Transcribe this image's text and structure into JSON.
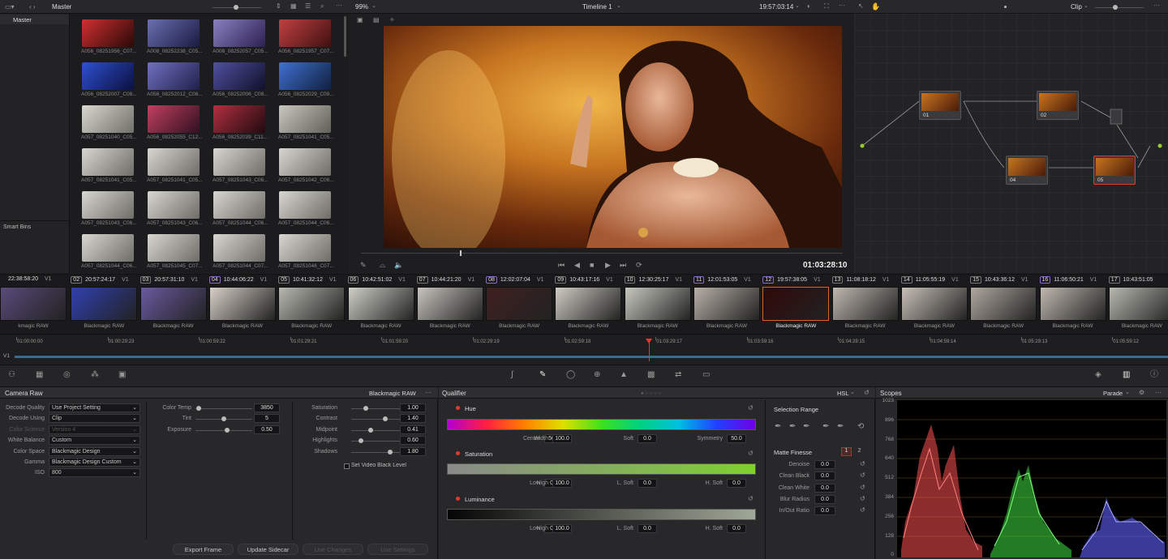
{
  "media_pool": {
    "title": "Master",
    "bins": [
      "Master"
    ],
    "smart_bins_label": "Smart Bins",
    "clips": [
      "A056_08251956_C07...",
      "A008_08252238_C05...",
      "A008_08252057_C05...",
      "A056_08251957_C07...",
      "A056_08252007_C08...",
      "A056_08252012_C08...",
      "A056_08252006_C08...",
      "A056_08252029_C09...",
      "A057_08251040_C05...",
      "A056_08252055_C12...",
      "A056_08252039_C11...",
      "A057_08251041_C05...",
      "A057_08251041_C05...",
      "A057_08251041_C05...",
      "A057_08251043_C06...",
      "A057_08251042_C06...",
      "A057_08251043_C06...",
      "A057_08251043_C06...",
      "A057_08251044_C06...",
      "A057_08251044_C06...",
      "A057_08251044_C06...",
      "A057_08251045_C07...",
      "A057_08251044_C07...",
      "A057_08251046_C07..."
    ]
  },
  "viewer": {
    "zoom": "99%",
    "timeline_name": "Timeline 1",
    "timecode_top": "19:57:03:14",
    "timecode_bottom": "01:03:28:10"
  },
  "node_editor": {
    "mode": "Clip",
    "nodes": [
      "01",
      "02",
      "04",
      "05"
    ]
  },
  "clip_strip": [
    {
      "num": "",
      "tc": "22:38:58:20",
      "track": "V1",
      "name": "kmagic RAW"
    },
    {
      "num": "02",
      "tc": "20:57:24:17",
      "track": "V1",
      "name": "Blackmagic RAW"
    },
    {
      "num": "03",
      "tc": "20:57:31:10",
      "track": "V1",
      "name": "Blackmagic RAW"
    },
    {
      "num": "04",
      "tc": "10:44:06:22",
      "track": "V1",
      "name": "Blackmagic RAW"
    },
    {
      "num": "05",
      "tc": "10:41:32:12",
      "track": "V1",
      "name": "Blackmagic RAW"
    },
    {
      "num": "06",
      "tc": "10:42:51:02",
      "track": "V1",
      "name": "Blackmagic RAW"
    },
    {
      "num": "07",
      "tc": "10:44:21:20",
      "track": "V1",
      "name": "Blackmagic RAW"
    },
    {
      "num": "08",
      "tc": "12:02:07:04",
      "track": "V1",
      "name": "Blackmagic RAW"
    },
    {
      "num": "09",
      "tc": "10:43:17:16",
      "track": "V1",
      "name": "Blackmagic RAW"
    },
    {
      "num": "10",
      "tc": "12:30:25:17",
      "track": "V1",
      "name": "Blackmagic RAW"
    },
    {
      "num": "11",
      "tc": "12:01:53:05",
      "track": "V1",
      "name": "Blackmagic RAW"
    },
    {
      "num": "12",
      "tc": "19:57:38:05",
      "track": "V1",
      "name": "Blackmagic RAW"
    },
    {
      "num": "13",
      "tc": "11:08:18:12",
      "track": "V1",
      "name": "Blackmagic RAW"
    },
    {
      "num": "14",
      "tc": "11:05:55:19",
      "track": "V1",
      "name": "Blackmagic RAW"
    },
    {
      "num": "15",
      "tc": "10:43:36:12",
      "track": "V1",
      "name": "Blackmagic RAW"
    },
    {
      "num": "16",
      "tc": "11:06:50:21",
      "track": "V1",
      "name": "Blackmagic RAW"
    },
    {
      "num": "17",
      "tc": "10:43:51:05",
      "track": "",
      "name": "Blackmagic RAW"
    }
  ],
  "ruler": [
    "01:00:00:00",
    "01:00:29:23",
    "01:00:59:22",
    "01:01:29:21",
    "01:01:59:20",
    "01:02:29:19",
    "01:02:59:18",
    "01:03:29:17",
    "01:03:59:16",
    "01:04:29:15",
    "01:04:59:14",
    "01:05:29:13",
    "01:05:59:12"
  ],
  "track_label": "V1",
  "camera_raw": {
    "title": "Camera Raw",
    "format": "Blackmagic RAW",
    "rows": [
      {
        "label": "Decode Quality",
        "value": "Use Project Setting",
        "disabled": false
      },
      {
        "label": "Decode Using",
        "value": "Clip",
        "disabled": false
      },
      {
        "label": "Color Science",
        "value": "Version 4",
        "disabled": true
      },
      {
        "label": "White Balance",
        "value": "Custom",
        "disabled": false
      },
      {
        "label": "Color Space",
        "value": "Blackmagic Design",
        "disabled": false
      },
      {
        "label": "Gamma",
        "value": "Blackmagic Design Custom",
        "disabled": false
      },
      {
        "label": "ISO",
        "value": "800",
        "disabled": false
      }
    ],
    "mid_sliders": [
      {
        "label": "Color Temp",
        "value": "3850",
        "pos": 0.05
      },
      {
        "label": "Tint",
        "value": "5",
        "pos": 0.5
      },
      {
        "label": "Exposure",
        "value": "0.50",
        "pos": 0.55
      }
    ],
    "right_sliders": [
      {
        "label": "Saturation",
        "value": "1.00",
        "pos": 0.3
      },
      {
        "label": "Contrast",
        "value": "1.40",
        "pos": 0.7
      },
      {
        "label": "Midpoint",
        "value": "0.41",
        "pos": 0.4
      },
      {
        "label": "Highlights",
        "value": "0.60",
        "pos": 0.2
      },
      {
        "label": "Shadows",
        "value": "1.80",
        "pos": 0.8
      }
    ],
    "video_black_label": "Set Video Black Level",
    "buttons": [
      {
        "label": "Export Frame",
        "disabled": false
      },
      {
        "label": "Update Sidecar",
        "disabled": false
      },
      {
        "label": "Use Changes",
        "disabled": true
      },
      {
        "label": "Use Settings",
        "disabled": true
      }
    ]
  },
  "qualifier": {
    "title": "Qualifier",
    "mode": "HSL",
    "hue": {
      "label": "Hue",
      "fields": [
        {
          "k": "Center",
          "v": "50.0"
        },
        {
          "k": "Width",
          "v": "100.0"
        },
        {
          "k": "Soft",
          "v": "0.0"
        },
        {
          "k": "Symmetry",
          "v": "50.0"
        }
      ]
    },
    "saturation": {
      "label": "Saturation",
      "fields": [
        {
          "k": "Low",
          "v": "0.0"
        },
        {
          "k": "High",
          "v": "100.0"
        },
        {
          "k": "L. Soft",
          "v": "0.0"
        },
        {
          "k": "H. Soft",
          "v": "0.0"
        }
      ]
    },
    "luminance": {
      "label": "Luminance",
      "fields": [
        {
          "k": "Low",
          "v": "0.0"
        },
        {
          "k": "High",
          "v": "100.0"
        },
        {
          "k": "L. Soft",
          "v": "0.0"
        },
        {
          "k": "H. Soft",
          "v": "0.0"
        }
      ]
    },
    "selection_range": "Selection Range",
    "matte_finesse": "Matte Finesse",
    "matte_tabs": [
      "1",
      "2"
    ],
    "matte_rows": [
      {
        "label": "Denoise",
        "value": "0.0"
      },
      {
        "label": "Clean Black",
        "value": "0.0"
      },
      {
        "label": "Clean White",
        "value": "0.0"
      },
      {
        "label": "Blur Radius",
        "value": "0.0"
      },
      {
        "label": "In/Out Ratio",
        "value": "0.0"
      }
    ]
  },
  "scopes": {
    "title": "Scopes",
    "mode": "Parade",
    "scale": [
      "1023",
      "896",
      "768",
      "640",
      "512",
      "384",
      "256",
      "128",
      "0"
    ]
  },
  "colors": {
    "accent": "#e03a2f",
    "panel": "#28282b",
    "bg": "#1e1e20"
  }
}
